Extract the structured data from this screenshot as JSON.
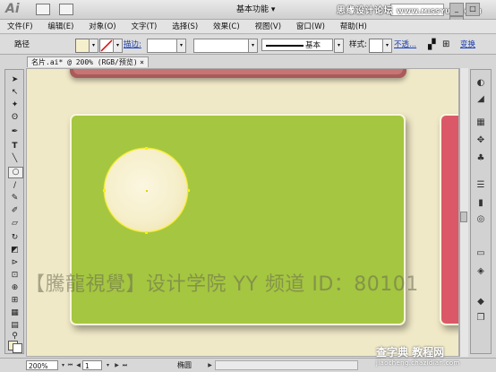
{
  "app": {
    "logo": "Ai",
    "workspace_label": "基本功能 ▾",
    "win_controls": [
      "_",
      "□",
      "✕"
    ]
  },
  "watermark_top": {
    "text": "思缘设计论坛",
    "sub": "WWW.MISSYUAN.COM"
  },
  "menu": [
    "文件(F)",
    "编辑(E)",
    "对象(O)",
    "文字(T)",
    "选择(S)",
    "效果(C)",
    "视图(V)",
    "窗口(W)",
    "帮助(H)"
  ],
  "control": {
    "path_label": "路径",
    "stroke_label": "描边:",
    "stroke_style": "基本",
    "style_label": "样式:",
    "opacity_label": "不透...",
    "transform_label": "变换"
  },
  "document": {
    "tab_title": "名片.ai* @ 200% (RGB/预览)",
    "close": "×"
  },
  "canvas_watermark": "【騰龍視覺】设计学院  YY 频道 ID：80101",
  "status": {
    "zoom": "200%",
    "page": "1",
    "selection": "椭圆"
  },
  "site_watermark": {
    "text": "查字典 教程网",
    "sub": "jiaocheng.chazidian.com"
  },
  "colors": {
    "canvas": "#f0e9c7",
    "card_green": "#a5c640",
    "card_pink": "#db5868",
    "circle": "#f6efcb"
  }
}
